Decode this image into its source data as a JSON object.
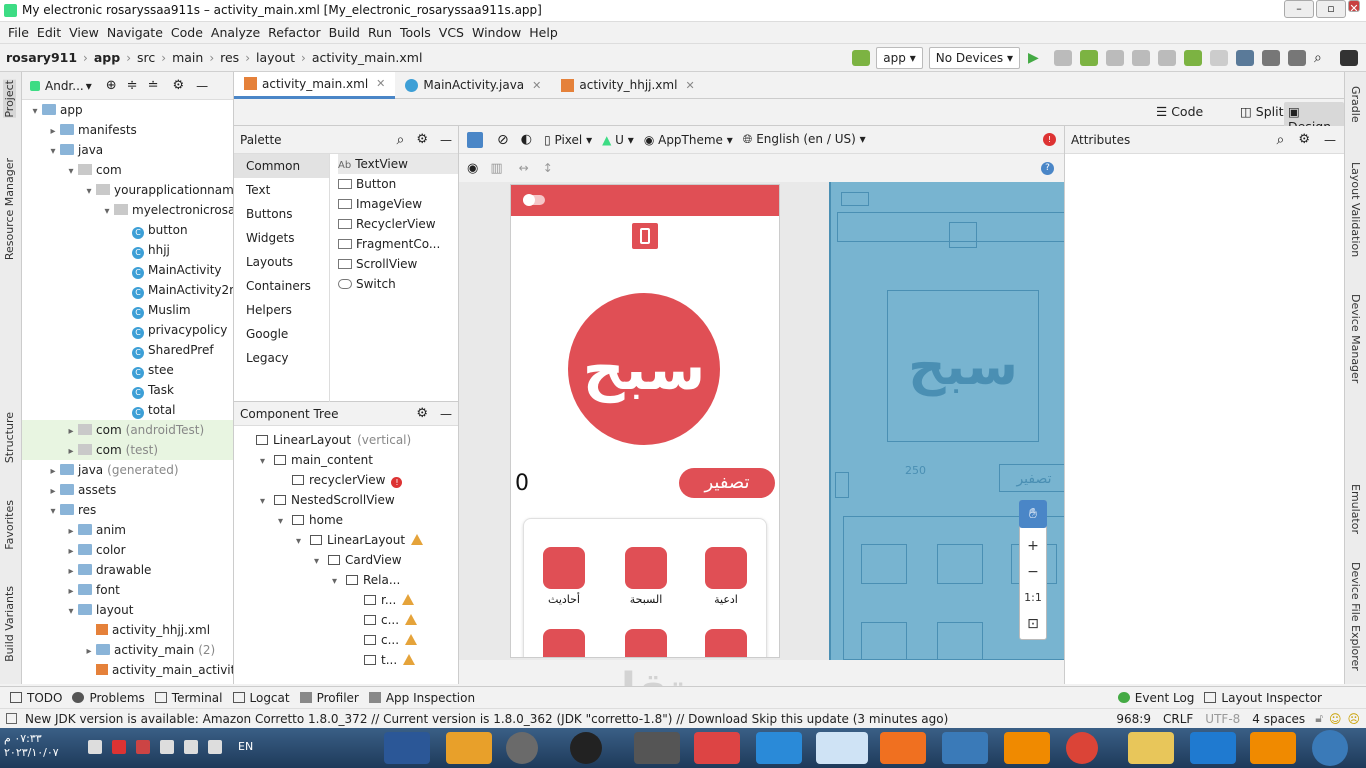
{
  "window": {
    "title": "My electronic rosaryssaa911s – activity_main.xml [My_electronic_rosaryssaa911s.app]"
  },
  "menu": [
    "File",
    "Edit",
    "View",
    "Navigate",
    "Code",
    "Analyze",
    "Refactor",
    "Build",
    "Run",
    "Tools",
    "VCS",
    "Window",
    "Help"
  ],
  "breadcrumb": [
    "rosary911",
    "app",
    "src",
    "main",
    "res",
    "layout",
    "activity_main.xml"
  ],
  "toolbar": {
    "config": "app",
    "device": "No Devices"
  },
  "project": {
    "selector": "Andr...",
    "nodes": [
      {
        "label": "app",
        "depth": 0,
        "arrow": "▾",
        "icon": "folder"
      },
      {
        "label": "manifests",
        "depth": 1,
        "arrow": "▸",
        "icon": "folder"
      },
      {
        "label": "java",
        "depth": 1,
        "arrow": "▾",
        "icon": "folder"
      },
      {
        "label": "com",
        "depth": 2,
        "arrow": "▾",
        "icon": "pkg"
      },
      {
        "label": "yourapplicationname",
        "depth": 3,
        "arrow": "▾",
        "icon": "pkg"
      },
      {
        "label": "myelectronicrosary",
        "depth": 4,
        "arrow": "▾",
        "icon": "pkg"
      },
      {
        "label": "button",
        "depth": 5,
        "arrow": "",
        "icon": "cls"
      },
      {
        "label": "hhjj",
        "depth": 5,
        "arrow": "",
        "icon": "cls"
      },
      {
        "label": "MainActivity",
        "depth": 5,
        "arrow": "",
        "icon": "cls"
      },
      {
        "label": "MainActivity2n",
        "depth": 5,
        "arrow": "",
        "icon": "cls"
      },
      {
        "label": "Muslim",
        "depth": 5,
        "arrow": "",
        "icon": "cls"
      },
      {
        "label": "privacypolicy",
        "depth": 5,
        "arrow": "",
        "icon": "cls"
      },
      {
        "label": "SharedPref",
        "depth": 5,
        "arrow": "",
        "icon": "cls"
      },
      {
        "label": "stee",
        "depth": 5,
        "arrow": "",
        "icon": "cls"
      },
      {
        "label": "Task",
        "depth": 5,
        "arrow": "",
        "icon": "cls"
      },
      {
        "label": "total",
        "depth": 5,
        "arrow": "",
        "icon": "cls"
      },
      {
        "label": "com",
        "suffix": "(androidTest)",
        "depth": 2,
        "arrow": "▸",
        "icon": "pkg",
        "green": true
      },
      {
        "label": "com",
        "suffix": "(test)",
        "depth": 2,
        "arrow": "▸",
        "icon": "pkg",
        "green": true
      },
      {
        "label": "java",
        "suffix": "(generated)",
        "depth": 1,
        "arrow": "▸",
        "icon": "folder"
      },
      {
        "label": "assets",
        "depth": 1,
        "arrow": "▸",
        "icon": "folder"
      },
      {
        "label": "res",
        "depth": 1,
        "arrow": "▾",
        "icon": "folder"
      },
      {
        "label": "anim",
        "depth": 2,
        "arrow": "▸",
        "icon": "folder"
      },
      {
        "label": "color",
        "depth": 2,
        "arrow": "▸",
        "icon": "folder"
      },
      {
        "label": "drawable",
        "depth": 2,
        "arrow": "▸",
        "icon": "folder"
      },
      {
        "label": "font",
        "depth": 2,
        "arrow": "▸",
        "icon": "folder"
      },
      {
        "label": "layout",
        "depth": 2,
        "arrow": "▾",
        "icon": "folder"
      },
      {
        "label": "activity_hhjj.xml",
        "depth": 3,
        "arrow": "",
        "icon": "xml"
      },
      {
        "label": "activity_main",
        "suffix": "(2)",
        "depth": 3,
        "arrow": "▸",
        "icon": "folder"
      },
      {
        "label": "activity_main_activity2",
        "depth": 3,
        "arrow": "",
        "icon": "xml"
      }
    ]
  },
  "editor_tabs": [
    {
      "label": "activity_main.xml",
      "active": true
    },
    {
      "label": "MainActivity.java",
      "active": false
    },
    {
      "label": "activity_hhjj.xml",
      "active": false
    }
  ],
  "view_modes": {
    "code": "Code",
    "split": "Split",
    "design": "Design"
  },
  "palette": {
    "title": "Palette",
    "categories": [
      "Common",
      "Text",
      "Buttons",
      "Widgets",
      "Layouts",
      "Containers",
      "Helpers",
      "Google",
      "Legacy"
    ],
    "items": [
      "TextView",
      "Button",
      "ImageView",
      "RecyclerView",
      "FragmentCo...",
      "ScrollView",
      "Switch"
    ]
  },
  "design_toolbar": {
    "device": "Pixel",
    "api": "U",
    "theme": "AppTheme",
    "locale": "English (en / US)"
  },
  "component_tree": {
    "title": "Component Tree",
    "nodes": [
      {
        "label": "LinearLayout",
        "suffix": "(vertical)",
        "depth": 0,
        "arrow": ""
      },
      {
        "label": "main_content",
        "depth": 1,
        "arrow": "▾"
      },
      {
        "label": "recyclerView",
        "depth": 2,
        "arrow": "",
        "status": "error"
      },
      {
        "label": "NestedScrollView",
        "depth": 1,
        "arrow": "▾"
      },
      {
        "label": "home",
        "depth": 2,
        "arrow": "▾"
      },
      {
        "label": "LinearLayout",
        "depth": 3,
        "arrow": "▾",
        "status": "warn"
      },
      {
        "label": "CardView",
        "depth": 4,
        "arrow": "▾"
      },
      {
        "label": "Rela...",
        "depth": 5,
        "arrow": "▾"
      },
      {
        "label": "r...",
        "depth": 6,
        "arrow": "",
        "status": "warn"
      },
      {
        "label": "c...",
        "depth": 6,
        "arrow": "",
        "status": "warn"
      },
      {
        "label": "c...",
        "depth": 6,
        "arrow": "",
        "status": "warn"
      },
      {
        "label": "t...",
        "depth": 6,
        "arrow": "",
        "status": "warn"
      }
    ]
  },
  "preview": {
    "tasbih_label": "سبح",
    "counter": "0",
    "reset_label": "تصفير",
    "grid": [
      {
        "label": "أحاديث",
        "color": "#e04f55"
      },
      {
        "label": "السبحة",
        "color": "#e04f55"
      },
      {
        "label": "ادعية",
        "color": "#e04f55"
      }
    ],
    "blueprint_number": "250",
    "blueprint_text": "تصفير"
  },
  "zoom": {
    "fit": "1:1"
  },
  "attributes": {
    "title": "Attributes"
  },
  "bottom_tools": [
    "TODO",
    "Problems",
    "Terminal",
    "Logcat",
    "Profiler",
    "App Inspection"
  ],
  "bottom_tools_right": [
    "Event Log",
    "Layout Inspector"
  ],
  "status": {
    "message": "New JDK version is available: Amazon Corretto 1.8.0_372 // Current version is 1.8.0_362 (JDK \"corretto-1.8\") // Download   Skip this update (3 minutes ago)",
    "position": "968:9",
    "line_sep": "CRLF",
    "encoding": "UTF-8",
    "indent": "4 spaces"
  },
  "side_tabs_left": [
    "Project",
    "Resource Manager",
    "Structure",
    "Favorites",
    "Build Variants"
  ],
  "side_tabs_right": [
    "Gradle",
    "Layout Validation",
    "Device Manager",
    "Emulator",
    "Device File Explorer"
  ],
  "taskbar": {
    "time": "٠٧:٣٣ م",
    "date": "٢٠٢٣/١٠/٠٧",
    "lang": "EN"
  },
  "watermark": "مستقل"
}
